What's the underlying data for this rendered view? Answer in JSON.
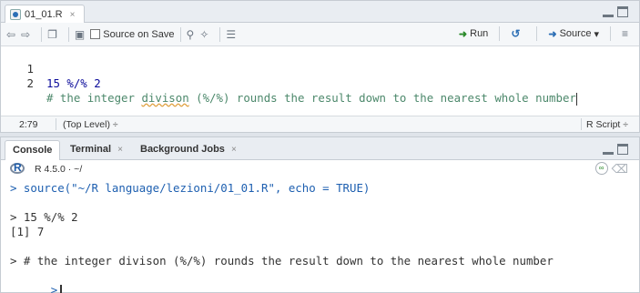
{
  "editor": {
    "tab": {
      "label": "01_01.R",
      "close": "×"
    },
    "toolbar": {
      "source_on_save": "Source on Save",
      "run": "Run",
      "source": "Source",
      "source_dropdown": "▾"
    },
    "lines": [
      {
        "num": "1",
        "parts": [
          {
            "text": "15 %/% 2",
            "cls": "c-num"
          }
        ]
      },
      {
        "num": "2",
        "parts": [
          {
            "text": "# the integer ",
            "cls": "c-comment"
          },
          {
            "text": "divison",
            "cls": "c-comment squiggle"
          },
          {
            "text": " (%/%) rounds the result down to the nearest whole number",
            "cls": "c-comment"
          }
        ]
      }
    ],
    "status": {
      "position": "2:79",
      "scope": "(Top Level) ÷",
      "filetype": "R Script ÷"
    }
  },
  "console": {
    "tabs": [
      {
        "label": "Console",
        "close": ""
      },
      {
        "label": "Terminal",
        "close": "×"
      },
      {
        "label": "Background Jobs",
        "close": "×"
      }
    ],
    "r_version": "R 4.5.0 · ~/",
    "lines": [
      {
        "text": "> source(\"~/R language/lezioni/01_01.R\", echo = TRUE)",
        "cls": "cmd-blue"
      },
      {
        "text": "",
        "cls": "out"
      },
      {
        "text": "> 15 %/% 2",
        "cls": "out"
      },
      {
        "text": "[1] 7",
        "cls": "out"
      },
      {
        "text": "",
        "cls": "out"
      },
      {
        "text": "> # the integer divison (%/%) rounds the result down to the nearest whole number",
        "cls": "out"
      }
    ],
    "prompt": ">"
  }
}
